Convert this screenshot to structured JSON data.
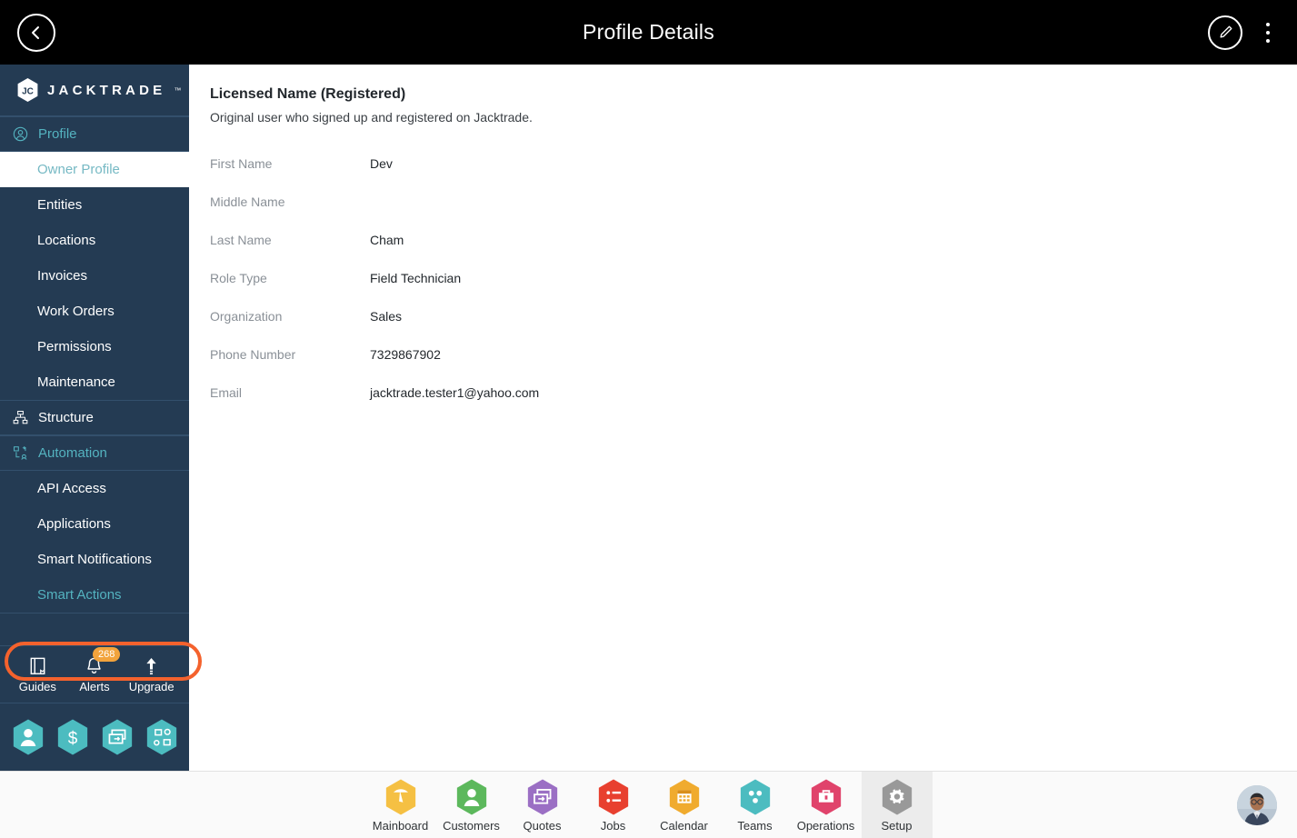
{
  "header": {
    "title": "Profile Details",
    "back_icon": "chevron-left-icon",
    "edit_icon": "pencil-edit-icon",
    "more_icon": "kebab-menu-icon"
  },
  "sidebar": {
    "brand": {
      "name": "JACKTRADE",
      "trademark": "™",
      "logo_icon": "jacktrade-hexagon-logo"
    },
    "groups": [
      {
        "label": "Profile",
        "icon": "user-circle-icon",
        "active": true,
        "items": [
          {
            "label": "Owner Profile",
            "active": true
          },
          {
            "label": "Entities",
            "active": false
          },
          {
            "label": "Locations",
            "active": false
          },
          {
            "label": "Invoices",
            "active": false
          },
          {
            "label": "Work Orders",
            "active": false
          },
          {
            "label": "Permissions",
            "active": false
          },
          {
            "label": "Maintenance",
            "active": false
          }
        ]
      },
      {
        "label": "Structure",
        "icon": "org-structure-icon",
        "active": false,
        "items": []
      },
      {
        "label": "Automation",
        "icon": "automation-flow-icon",
        "active": true,
        "items": [
          {
            "label": "API Access",
            "active": false
          },
          {
            "label": "Applications",
            "active": false
          },
          {
            "label": "Smart Notifications",
            "active": false
          },
          {
            "label": "Smart Actions",
            "active": true,
            "highlighted": true
          }
        ]
      }
    ],
    "tools": [
      {
        "label": "Guides",
        "icon": "book-icon",
        "badge": null
      },
      {
        "label": "Alerts",
        "icon": "bell-icon",
        "badge": "268"
      },
      {
        "label": "Upgrade",
        "icon": "upgrade-arrow-icon",
        "badge": null
      }
    ],
    "quick_actions": [
      {
        "icon": "person-hex-icon"
      },
      {
        "icon": "dollar-hex-icon"
      },
      {
        "icon": "money-bill-hex-icon"
      },
      {
        "icon": "workflow-hex-icon"
      }
    ]
  },
  "content": {
    "section_title": "Licensed Name (Registered)",
    "section_subtitle": "Original user who signed up and registered on Jacktrade.",
    "fields": [
      {
        "label": "First Name",
        "value": "Dev"
      },
      {
        "label": "Middle Name",
        "value": ""
      },
      {
        "label": "Last Name",
        "value": "Cham"
      },
      {
        "label": "Role Type",
        "value": "Field Technician"
      },
      {
        "label": "Organization",
        "value": "Sales"
      },
      {
        "label": "Phone Number",
        "value": "7329867902"
      },
      {
        "label": "Email",
        "value": "jacktrade.tester1@yahoo.com"
      }
    ]
  },
  "bottom_nav": {
    "tabs": [
      {
        "label": "Mainboard",
        "icon": "mainboard-hex-icon",
        "color": "#f5c043",
        "active": false
      },
      {
        "label": "Customers",
        "icon": "customers-hex-icon",
        "color": "#5cb85c",
        "active": false
      },
      {
        "label": "Quotes",
        "icon": "quotes-hex-icon",
        "color": "#9b6fc4",
        "active": false
      },
      {
        "label": "Jobs",
        "icon": "jobs-hex-icon",
        "color": "#e8402f",
        "active": false
      },
      {
        "label": "Calendar",
        "icon": "calendar-hex-icon",
        "color": "#f0ab2e",
        "active": false
      },
      {
        "label": "Teams",
        "icon": "teams-hex-icon",
        "color": "#4cbcc0",
        "active": false
      },
      {
        "label": "Operations",
        "icon": "operations-hex-icon",
        "color": "#e0436b",
        "active": false
      },
      {
        "label": "Setup",
        "icon": "setup-gear-hex-icon",
        "color": "#999999",
        "active": true
      }
    ],
    "avatar": "user-avatar-photo"
  },
  "colors": {
    "sidebar_bg": "#243b53",
    "sidebar_accent": "#54b3c0",
    "annotation": "#f4622d",
    "badge": "#f2a33c",
    "header_bg": "#000000"
  }
}
